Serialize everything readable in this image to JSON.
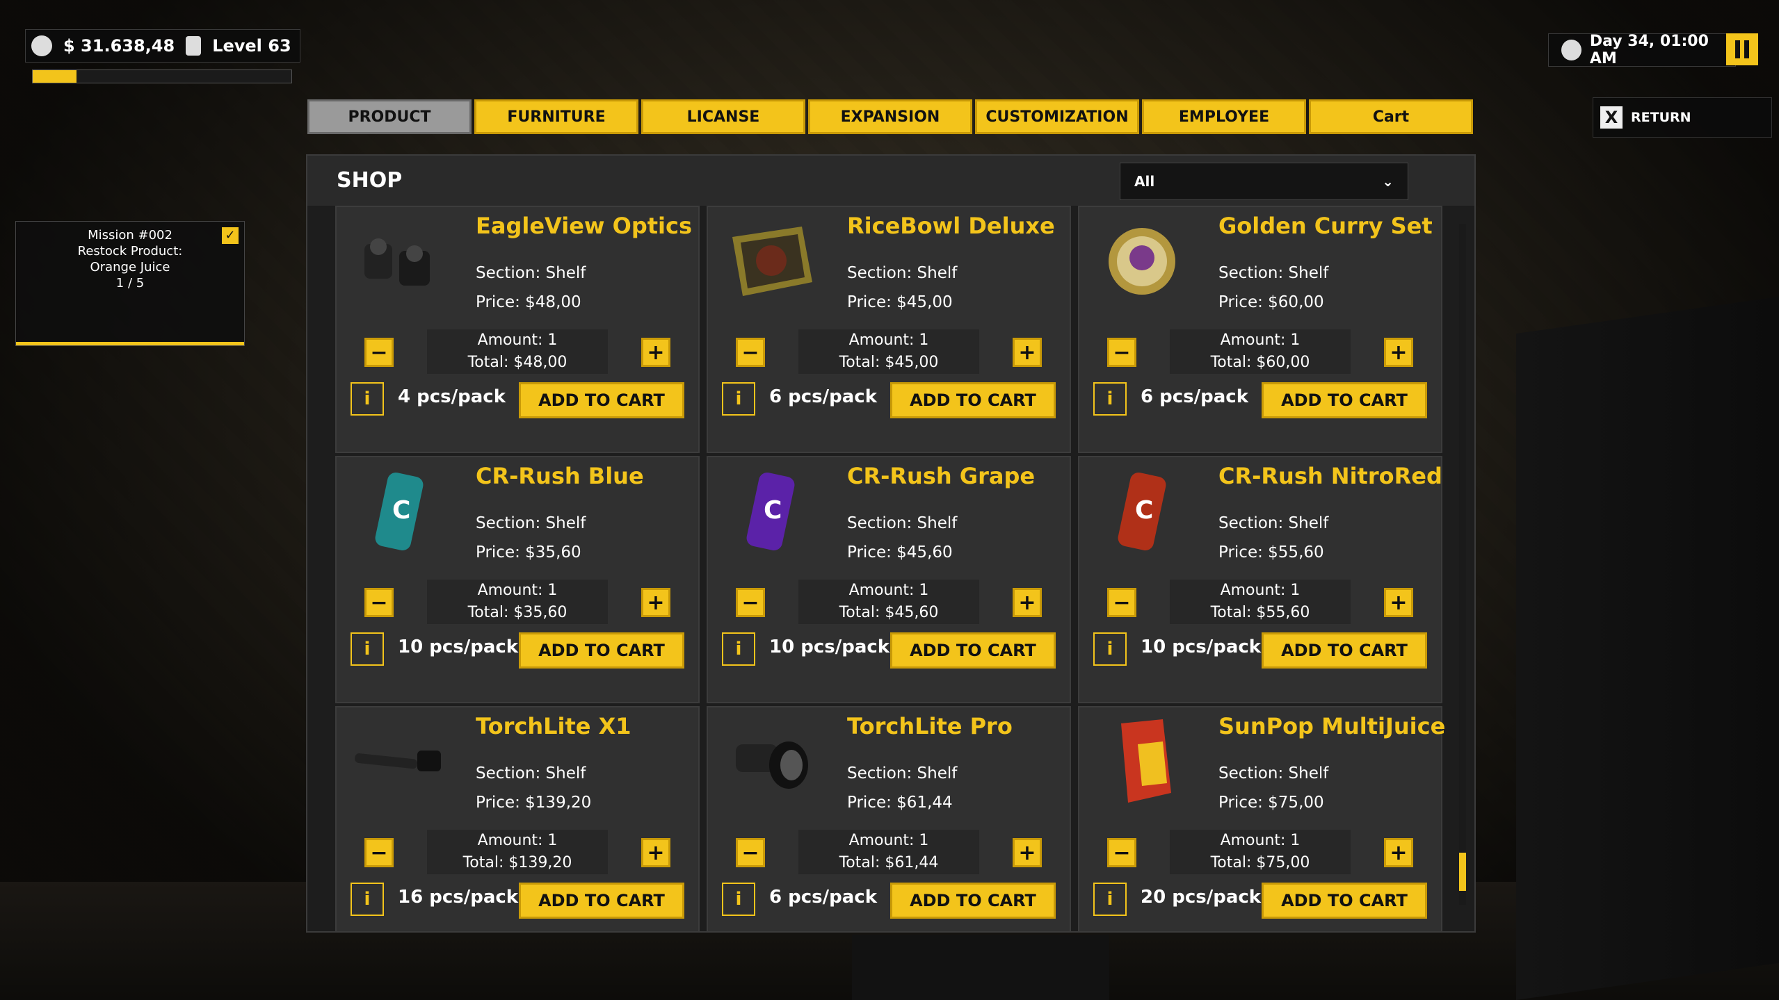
{
  "hud": {
    "money": "$ 31.638,48",
    "level": "Level 63",
    "xp_progress": 0.17,
    "day_time": "Day 34, 01:00 AM"
  },
  "tabs": [
    "PRODUCT",
    "FURNITURE",
    "LICANSE",
    "EXPANSION",
    "CUSTOMIZATION",
    "EMPLOYEE",
    "Cart"
  ],
  "active_tab": "PRODUCT",
  "return": {
    "key": "X",
    "label": "RETURN"
  },
  "mission": {
    "line1": "Mission #002",
    "line2": "Restock Product:",
    "line3": "Orange Juice",
    "progress": "1 / 5"
  },
  "shop": {
    "title": "SHOP",
    "filter": "All",
    "info_label": "i",
    "add_label": "ADD TO CART",
    "products": [
      {
        "name": "EagleView Optics",
        "section": "Section: Shelf",
        "price": "Price: $48,00",
        "amount": "Amount: 1",
        "total": "Total: $48,00",
        "pack": "4 pcs/pack",
        "icon": "binoculars-icon"
      },
      {
        "name": "RiceBowl Deluxe",
        "section": "Section: Shelf",
        "price": "Price: $45,00",
        "amount": "Amount: 1",
        "total": "Total: $45,00",
        "pack": "6 pcs/pack",
        "icon": "rice-tray-icon"
      },
      {
        "name": "Golden Curry Set",
        "section": "Section: Shelf",
        "price": "Price: $60,00",
        "amount": "Amount: 1",
        "total": "Total: $60,00",
        "pack": "6 pcs/pack",
        "icon": "curry-plate-icon"
      },
      {
        "name": "CR-Rush Blue",
        "section": "Section: Shelf",
        "price": "Price: $35,60",
        "amount": "Amount: 1",
        "total": "Total: $35,60",
        "pack": "10 pcs/pack",
        "icon": "can-blue-icon"
      },
      {
        "name": "CR-Rush Grape",
        "section": "Section: Shelf",
        "price": "Price: $45,60",
        "amount": "Amount: 1",
        "total": "Total: $45,60",
        "pack": "10 pcs/pack",
        "icon": "can-grape-icon"
      },
      {
        "name": "CR-Rush NitroRed",
        "section": "Section: Shelf",
        "price": "Price: $55,60",
        "amount": "Amount: 1",
        "total": "Total: $55,60",
        "pack": "10 pcs/pack",
        "icon": "can-red-icon"
      },
      {
        "name": "TorchLite X1",
        "section": "Section: Shelf",
        "price": "Price: $139,20",
        "amount": "Amount: 1",
        "total": "Total: $139,20",
        "pack": "16 pcs/pack",
        "icon": "flashlight-icon"
      },
      {
        "name": "TorchLite Pro",
        "section": "Section: Shelf",
        "price": "Price: $61,44",
        "amount": "Amount: 1",
        "total": "Total: $61,44",
        "pack": "6 pcs/pack",
        "icon": "flashlight-pro-icon"
      },
      {
        "name": "SunPop MultiJuice",
        "section": "Section: Shelf",
        "price": "Price: $75,00",
        "amount": "Amount: 1",
        "total": "Total: $75,00",
        "pack": "20 pcs/pack",
        "icon": "juice-box-icon"
      }
    ]
  },
  "colors": {
    "accent": "#f3c41b",
    "panel": "#303030",
    "active_tab": "#9a9a9a"
  }
}
